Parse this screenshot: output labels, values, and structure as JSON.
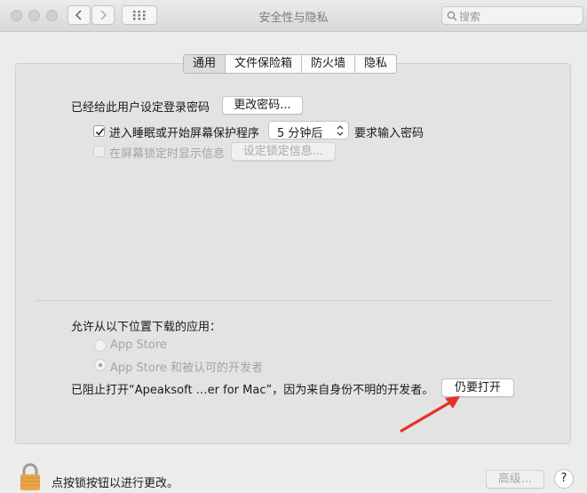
{
  "window": {
    "title": "安全性与隐私"
  },
  "search": {
    "placeholder": "搜索"
  },
  "tabs": [
    {
      "label": "通用",
      "active": true
    },
    {
      "label": "文件保险箱",
      "active": false
    },
    {
      "label": "防火墙",
      "active": false
    },
    {
      "label": "隐私",
      "active": false
    }
  ],
  "general": {
    "password_label": "已经给此用户设定登录密码",
    "change_password_button": "更改密码...",
    "require_password": {
      "label": "进入睡眠或开始屏幕保护程序",
      "checked": true,
      "delay_value": "5 分钟后",
      "suffix": "要求输入密码"
    },
    "show_message": {
      "label": "在屏幕锁定时显示信息",
      "checked": false,
      "enabled": false,
      "button": "设定锁定信息..."
    }
  },
  "downloads": {
    "heading": "允许从以下位置下载的应用：",
    "options": [
      {
        "label": "App Store",
        "selected": false
      },
      {
        "label": "App Store 和被认可的开发者",
        "selected": true
      }
    ],
    "blocked_message": "已阻止打开“Apeaksoft …er for Mac”，因为来自身份不明的开发者。",
    "open_anyway_button": "仍要打开"
  },
  "footer": {
    "lock_text": "点按锁按钮以进行更改。",
    "advanced_button": "高级...",
    "help_button": "?"
  },
  "colors": {
    "arrow": "#e8302a",
    "lock": "#e8a64a"
  }
}
